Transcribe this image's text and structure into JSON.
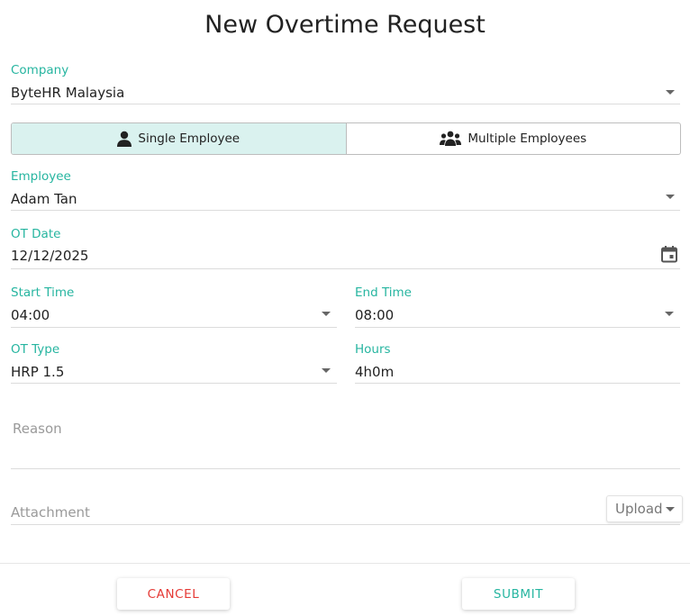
{
  "title": "New Overtime Request",
  "company": {
    "label": "Company",
    "value": "ByteHR Malaysia"
  },
  "mode_toggle": {
    "single_label": "Single Employee",
    "multiple_label": "Multiple Employees",
    "selected": "single"
  },
  "employee": {
    "label": "Employee",
    "value": "Adam Tan"
  },
  "ot_date": {
    "label": "OT Date",
    "value": "12/12/2025"
  },
  "start_time": {
    "label": "Start Time",
    "value": "04:00"
  },
  "end_time": {
    "label": "End Time",
    "value": "08:00"
  },
  "ot_type": {
    "label": "OT Type",
    "value": "HRP 1.5"
  },
  "hours": {
    "label": "Hours",
    "value": "4h0m"
  },
  "reason": {
    "placeholder": "Reason"
  },
  "attachment": {
    "placeholder": "Attachment",
    "upload_label": "Upload"
  },
  "actions": {
    "cancel_label": "CANCEL",
    "submit_label": "SUBMIT"
  },
  "colors": {
    "accent": "#26b5a0",
    "selected_bg": "#daf2ef",
    "cancel": "#e53935"
  },
  "icons": [
    "person-icon",
    "group-icon",
    "calendar-icon",
    "chevron-down-icon"
  ]
}
